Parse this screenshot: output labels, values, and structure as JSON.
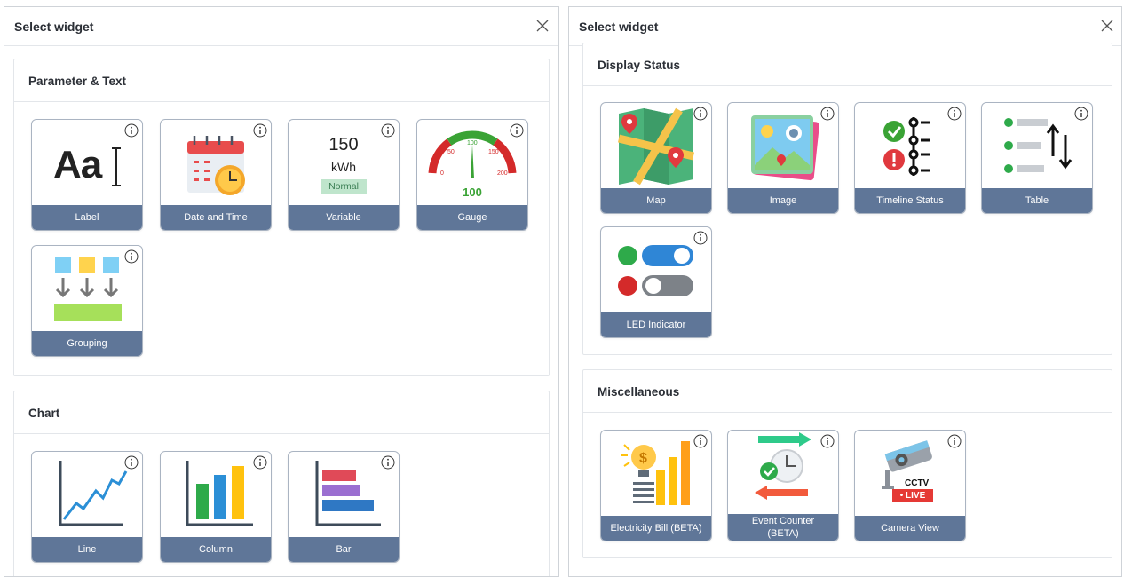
{
  "left_panel": {
    "title": "Select widget",
    "sections": [
      {
        "title": "Parameter & Text",
        "widgets": [
          {
            "label": "Label",
            "icon": "text-label-icon"
          },
          {
            "label": "Date and Time",
            "icon": "calendar-clock-icon"
          },
          {
            "label": "Variable",
            "icon": "variable-icon",
            "preview": {
              "value": "150",
              "unit": "kWh",
              "status": "Normal"
            }
          },
          {
            "label": "Gauge",
            "icon": "gauge-icon",
            "preview": {
              "value": "100",
              "ticks": [
                "0",
                "50",
                "100",
                "150",
                "200"
              ]
            }
          },
          {
            "label": "Grouping",
            "icon": "grouping-icon"
          }
        ]
      },
      {
        "title": "Chart",
        "widgets": [
          {
            "label": "Line",
            "icon": "line-chart-icon"
          },
          {
            "label": "Column",
            "icon": "column-chart-icon"
          },
          {
            "label": "Bar",
            "icon": "bar-chart-icon"
          }
        ]
      }
    ]
  },
  "right_panel": {
    "title": "Select widget",
    "sections": [
      {
        "title": "Display Status",
        "widgets": [
          {
            "label": "Map",
            "icon": "map-icon"
          },
          {
            "label": "Image",
            "icon": "image-icon"
          },
          {
            "label": "Timeline Status",
            "icon": "timeline-status-icon"
          },
          {
            "label": "Table",
            "icon": "table-sort-icon"
          },
          {
            "label": "LED Indicator",
            "icon": "led-indicator-icon"
          }
        ]
      },
      {
        "title": "Miscellaneous",
        "widgets": [
          {
            "label": "Electricity Bill (BETA)",
            "icon": "electricity-bill-icon"
          },
          {
            "label": "Event Counter (BETA)",
            "icon": "event-counter-icon"
          },
          {
            "label": "Camera View",
            "icon": "camera-view-icon",
            "preview": {
              "text": "CCTV",
              "badge": "• LIVE"
            }
          }
        ]
      }
    ]
  },
  "colors": {
    "card_footer": "#5f7698",
    "card_border": "#aab4c2",
    "status_badge_bg": "#bfe5cc",
    "live_red": "#e53935"
  }
}
